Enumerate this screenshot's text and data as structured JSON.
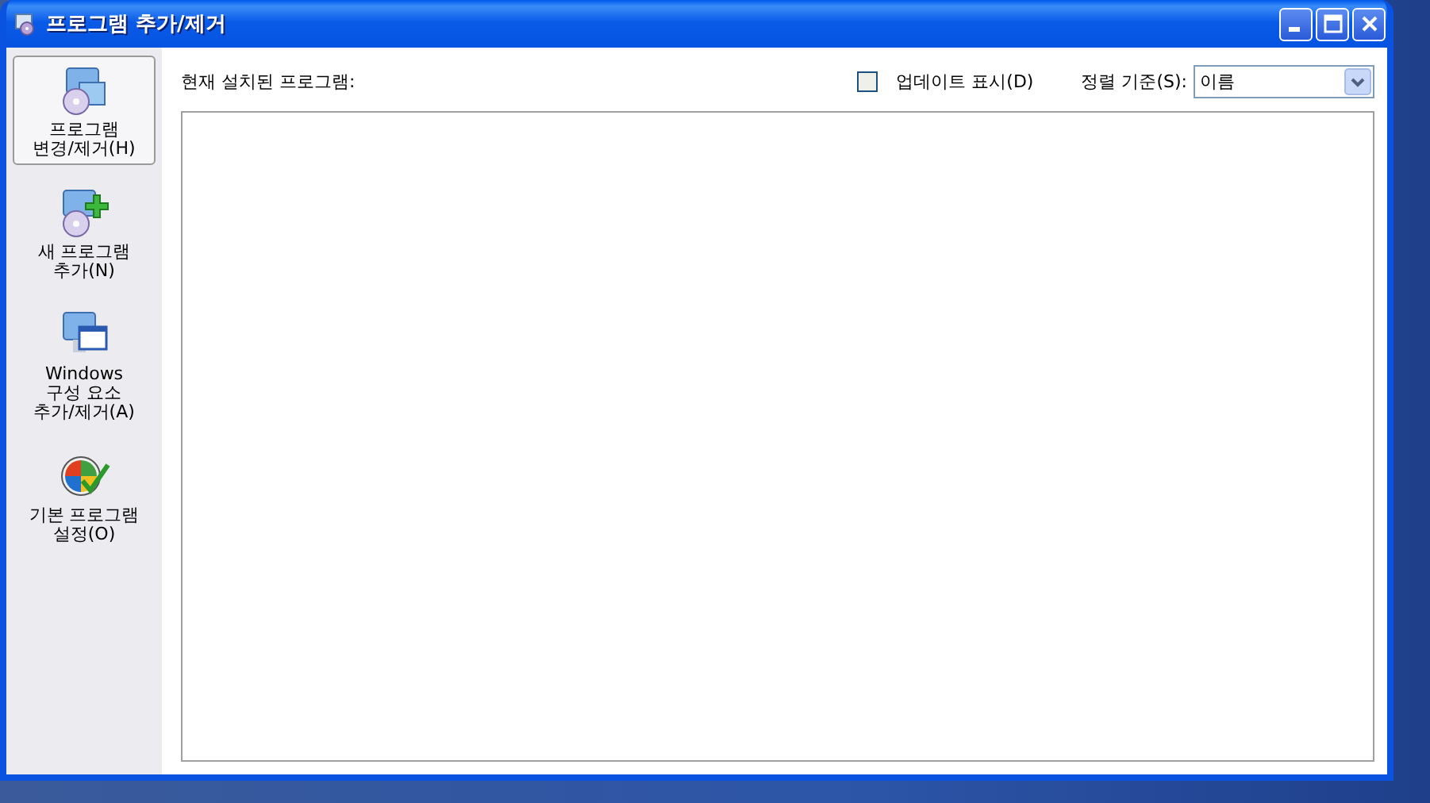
{
  "window": {
    "title": "프로그램 추가/제거"
  },
  "sidebar": {
    "items": [
      {
        "kind": "change",
        "label": "프로그램\n변경/제거(H)",
        "selected": true
      },
      {
        "kind": "add",
        "label": "새 프로그램\n추가(N)",
        "selected": false
      },
      {
        "kind": "components",
        "label": "Windows\n구성 요소\n추가/제거(A)",
        "selected": false
      },
      {
        "kind": "defaults",
        "label": "기본 프로그램\n설정(O)",
        "selected": false
      }
    ]
  },
  "content": {
    "list_label": "현재 설치된 프로그램:",
    "show_updates": {
      "label": "업데이트 표시(D)",
      "checked": false
    },
    "sort": {
      "label": "정렬 기준(S):",
      "value": "이름"
    }
  }
}
